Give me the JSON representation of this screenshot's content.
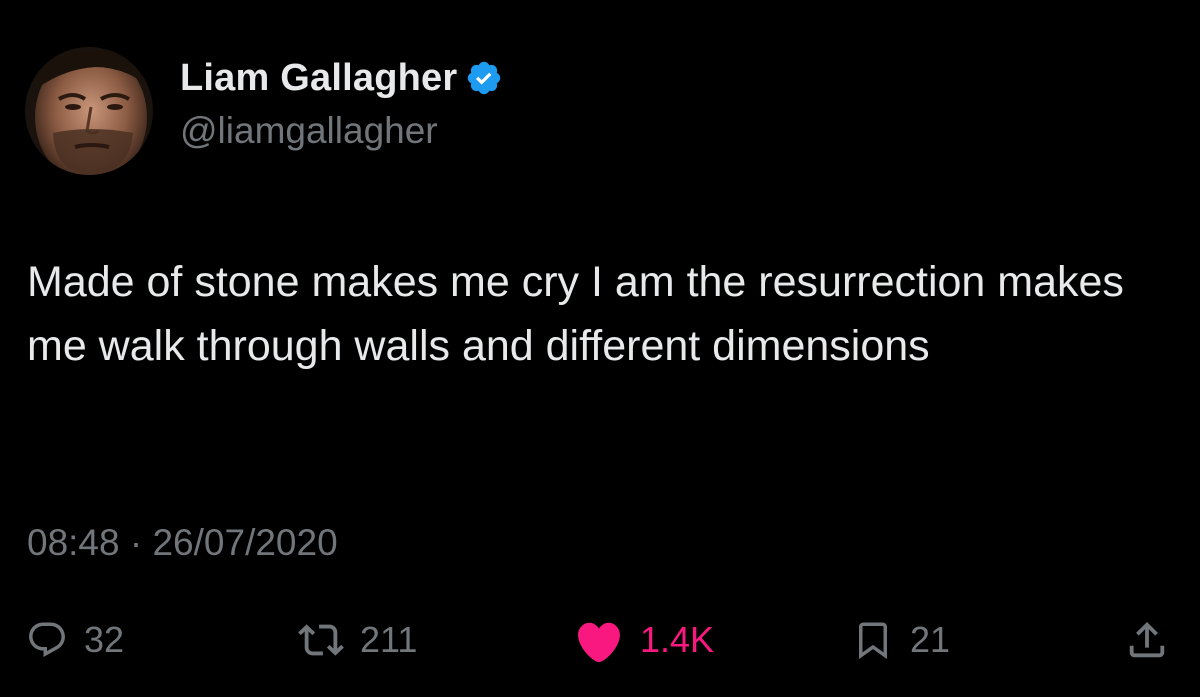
{
  "author": {
    "display_name": "Liam Gallagher",
    "handle": "@liamgallagher",
    "verified": true,
    "verified_color": "#1d9bf0"
  },
  "tweet": {
    "text": "Made of stone makes me cry I am the resurrection makes me walk through walls and different dimensions",
    "time": "08:48",
    "separator": "·",
    "date": "26/07/2020"
  },
  "actions": {
    "reply": {
      "icon": "reply-icon",
      "count": "32"
    },
    "retweet": {
      "icon": "retweet-icon",
      "count": "211"
    },
    "like": {
      "icon": "heart-icon",
      "count": "1.4K",
      "liked": true,
      "color": "#f91880"
    },
    "bookmark": {
      "icon": "bookmark-icon",
      "count": "21"
    },
    "share": {
      "icon": "share-icon"
    }
  },
  "colors": {
    "background": "#000000",
    "text": "#e7e9ea",
    "secondary": "#71767b"
  }
}
